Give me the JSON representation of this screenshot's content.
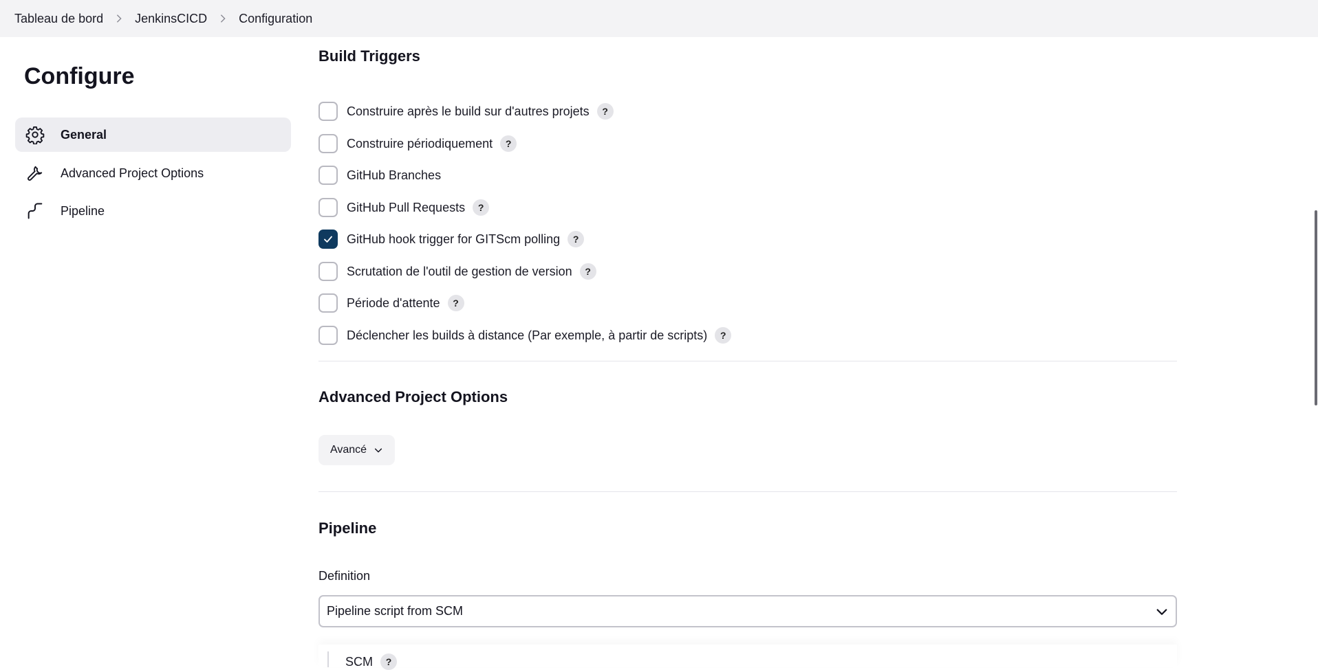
{
  "breadcrumb": {
    "items": [
      "Tableau de bord",
      "JenkinsCICD",
      "Configuration"
    ]
  },
  "sidebar": {
    "title": "Configure",
    "items": [
      {
        "label": "General",
        "icon": "gear-icon",
        "active": true
      },
      {
        "label": "Advanced Project Options",
        "icon": "wrench-icon",
        "active": false
      },
      {
        "label": "Pipeline",
        "icon": "pipeline-icon",
        "active": false
      }
    ]
  },
  "build_triggers": {
    "title": "Build Triggers",
    "items": [
      {
        "label": "Construire après le build sur d'autres projets",
        "checked": false,
        "help": "?"
      },
      {
        "label": "Construire périodiquement",
        "checked": false,
        "help": "?"
      },
      {
        "label": "GitHub Branches",
        "checked": false,
        "help": null
      },
      {
        "label": "GitHub Pull Requests",
        "checked": false,
        "help": "?"
      },
      {
        "label": "GitHub hook trigger for GITScm polling",
        "checked": true,
        "help": "?"
      },
      {
        "label": "Scrutation de l'outil de gestion de version",
        "checked": false,
        "help": "?"
      },
      {
        "label": "Période d'attente",
        "checked": false,
        "help": "?"
      },
      {
        "label": "Déclencher les builds à distance (Par exemple, à partir de scripts)",
        "checked": false,
        "help": "?"
      }
    ]
  },
  "advanced_options": {
    "title": "Advanced Project Options",
    "button_label": "Avancé"
  },
  "pipeline": {
    "title": "Pipeline",
    "definition_label": "Definition",
    "definition_value": "Pipeline script from SCM",
    "scm_label": "SCM",
    "scm_help": "?"
  },
  "colors": {
    "topbar_bg": "#f3f3f5",
    "active_item_bg": "#ededf1",
    "checkbox_checked": "#0f3a5f",
    "help_badge_bg": "#e4e4e8"
  }
}
